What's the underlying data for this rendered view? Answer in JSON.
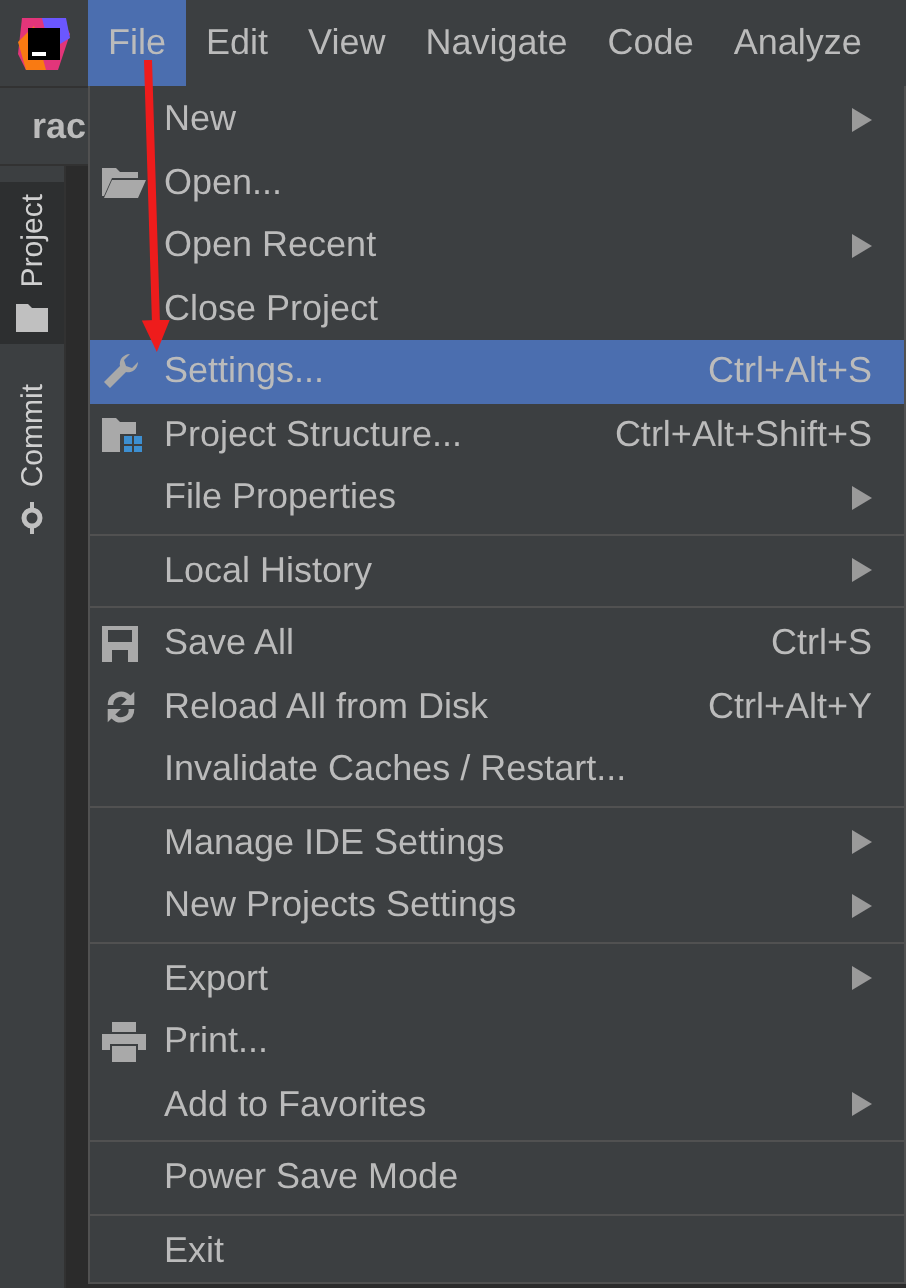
{
  "menubar": [
    {
      "label": "File",
      "selected": true
    },
    {
      "label": "Edit",
      "selected": false
    },
    {
      "label": "View",
      "selected": false
    },
    {
      "label": "Navigate",
      "selected": false
    },
    {
      "label": "Code",
      "selected": false
    },
    {
      "label": "Analyze",
      "selected": false
    }
  ],
  "tool_stripe": [
    {
      "label": "Project",
      "selected": true
    },
    {
      "label": "Commit",
      "selected": false
    }
  ],
  "editor_tab": "rac",
  "file_menu": [
    {
      "kind": "item",
      "label": "New",
      "submenu": true,
      "selected": false
    },
    {
      "kind": "item",
      "label": "Open...",
      "selected": false
    },
    {
      "kind": "item",
      "label": "Open Recent",
      "submenu": true,
      "selected": false
    },
    {
      "kind": "item",
      "label": "Close Project",
      "selected": false
    },
    {
      "kind": "item",
      "label": "Settings...",
      "shortcut": "Ctrl+Alt+S",
      "selected": true
    },
    {
      "kind": "item",
      "label": "Project Structure...",
      "shortcut": "Ctrl+Alt+Shift+S",
      "selected": false
    },
    {
      "kind": "item",
      "label": "File Properties",
      "submenu": true,
      "selected": false
    },
    {
      "kind": "separator"
    },
    {
      "kind": "item",
      "label": "Local History",
      "submenu": true,
      "selected": false
    },
    {
      "kind": "separator"
    },
    {
      "kind": "item",
      "label": "Save All",
      "shortcut": "Ctrl+S",
      "selected": false
    },
    {
      "kind": "item",
      "label": "Reload All from Disk",
      "shortcut": "Ctrl+Alt+Y",
      "selected": false
    },
    {
      "kind": "item",
      "label": "Invalidate Caches / Restart...",
      "selected": false
    },
    {
      "kind": "separator"
    },
    {
      "kind": "item",
      "label": "Manage IDE Settings",
      "submenu": true,
      "selected": false
    },
    {
      "kind": "item",
      "label": "New Projects Settings",
      "submenu": true,
      "selected": false
    },
    {
      "kind": "separator"
    },
    {
      "kind": "item",
      "label": "Export",
      "submenu": true,
      "selected": false
    },
    {
      "kind": "item",
      "label": "Print...",
      "selected": false
    },
    {
      "kind": "item",
      "label": "Add to Favorites",
      "submenu": true,
      "selected": false
    },
    {
      "kind": "separator"
    },
    {
      "kind": "item",
      "label": "Power Save Mode",
      "selected": false
    },
    {
      "kind": "separator"
    },
    {
      "kind": "item",
      "label": "Exit",
      "selected": false
    }
  ]
}
